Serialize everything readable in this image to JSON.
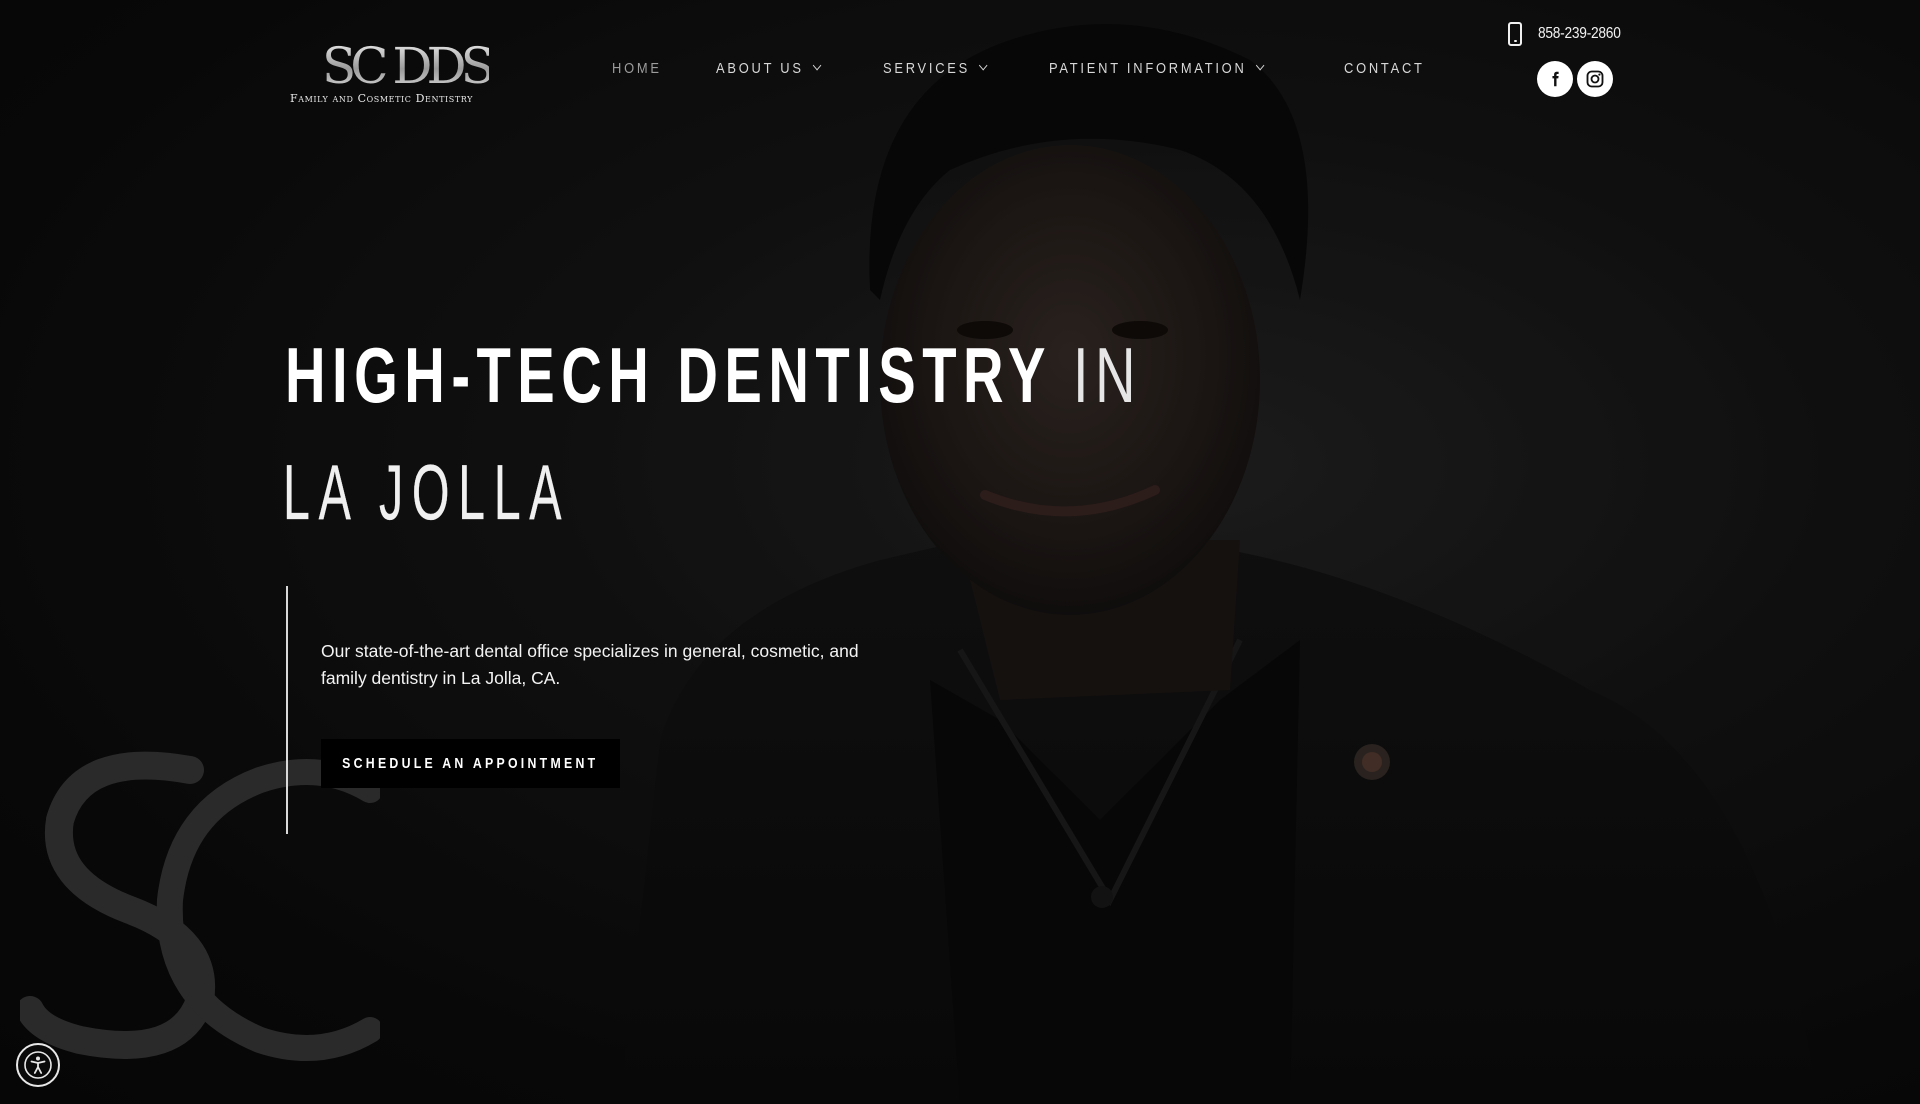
{
  "header": {
    "logo_mark": "SC DDS",
    "logo_tagline": "Family and Cosmetic Dentistry",
    "phone": "858-239-2860"
  },
  "nav": {
    "items": [
      {
        "label": "HOME",
        "has_dropdown": false,
        "active": true
      },
      {
        "label": "ABOUT US",
        "has_dropdown": true,
        "active": false
      },
      {
        "label": "SERVICES",
        "has_dropdown": true,
        "active": false
      },
      {
        "label": "PATIENT INFORMATION",
        "has_dropdown": true,
        "active": false
      },
      {
        "label": "CONTACT",
        "has_dropdown": false,
        "active": false
      }
    ]
  },
  "social": {
    "icons": [
      "facebook-icon",
      "instagram-icon"
    ]
  },
  "hero": {
    "title_bold": "HIGH-TECH DENTISTRY",
    "title_light": "IN",
    "subtitle": "LA JOLLA",
    "description": "Our state-of-the-art dental office specializes in general, cosmetic, and family dentistry in La Jolla, CA.",
    "cta_label": "SCHEDULE AN APPOINTMENT"
  },
  "colors": {
    "background": "#0d0d0d",
    "text_primary": "#ffffff",
    "button_bg": "#000000",
    "social_bg": "#ffffff"
  }
}
